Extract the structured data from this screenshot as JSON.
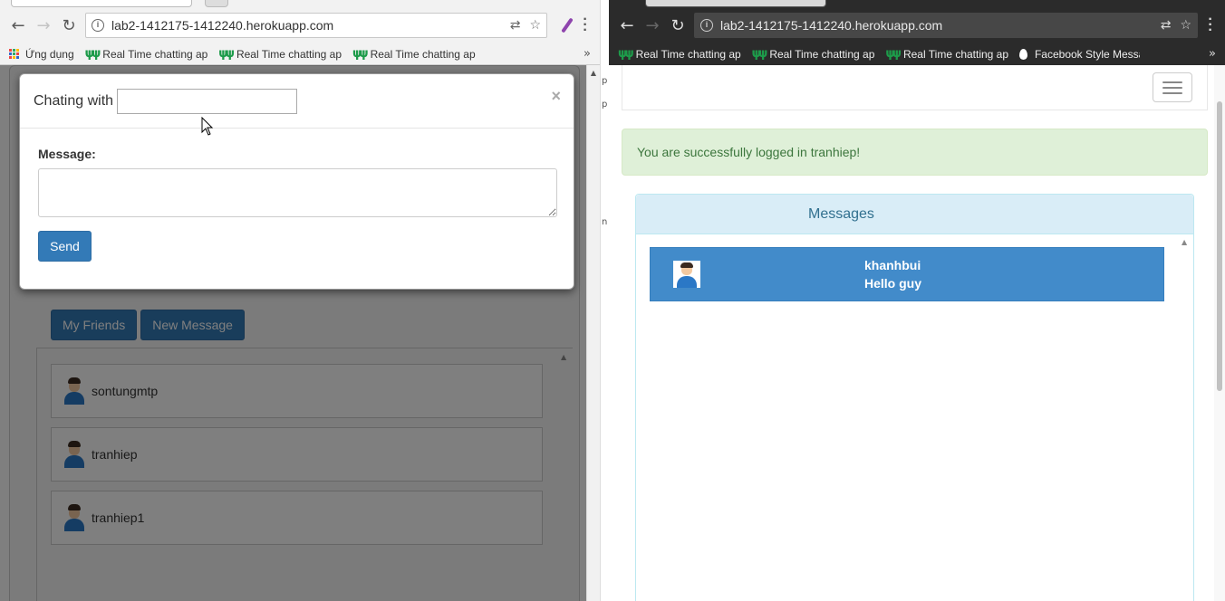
{
  "left_window": {
    "url": "lab2-1412175-1412240.herokuapp.com",
    "bookmarks": [
      "Ứng dụng",
      "Real Time chatting ap",
      "Real Time chatting ap",
      "Real Time chatting ap"
    ],
    "modal": {
      "title": "Chating with",
      "chat_with_value": "",
      "close": "×",
      "message_label": "Message:",
      "message_value": "",
      "send_label": "Send"
    },
    "tabs": [
      "My Friends",
      "New Message"
    ],
    "friends": [
      "sontungmtp",
      "tranhiep",
      "tranhiep1"
    ]
  },
  "right_window": {
    "url": "lab2-1412175-1412240.herokuapp.com",
    "bookmarks": [
      "Real Time chatting ap",
      "Real Time chatting ap",
      "Real Time chatting ap",
      "Facebook Style Messa"
    ],
    "alert": "You are successfully logged in tranhiep!",
    "panel_title": "Messages",
    "messages": [
      {
        "sender": "khanhbui",
        "text": "Hello guy"
      }
    ]
  },
  "colors": {
    "primary": "#337ab7",
    "alert_bg": "#dff0d8",
    "alert_text": "#3c763d",
    "panel_heading": "#d9edf7",
    "message_bg": "#428bca"
  }
}
